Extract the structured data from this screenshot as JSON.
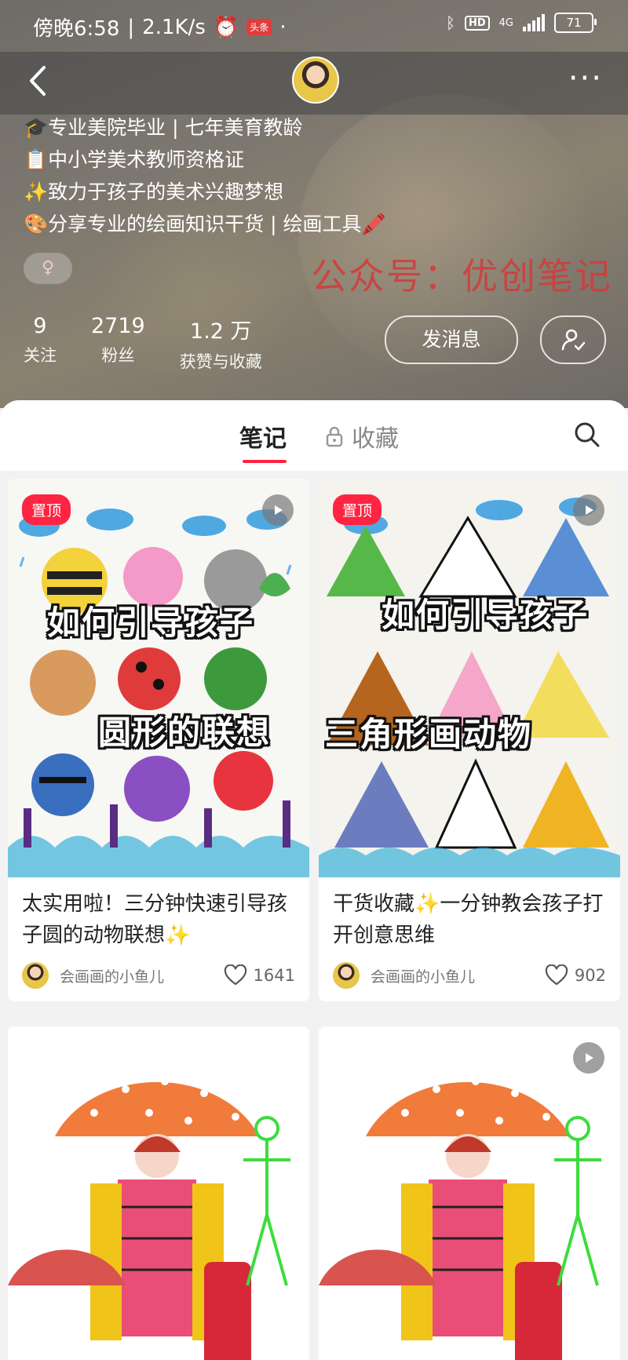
{
  "status_bar": {
    "time": "傍晚6:58",
    "speed": "2.1K/s",
    "app_badge": "头条",
    "dot": "·",
    "hd": "HD",
    "network": "4G",
    "battery": "71"
  },
  "nav": {
    "back_icon": "chevron-left-icon",
    "more_label": "···"
  },
  "bio": {
    "lines": [
      "🎓专业美院毕业 | 七年美育教龄",
      "📋中小学美术教师资格证",
      "✨致力于孩子的美术兴趣梦想",
      "🎨分享专业的绘画知识干货 | 绘画工具🖍️"
    ],
    "gender_symbol": "♀",
    "watermark": "公众号：优创笔记"
  },
  "stats": {
    "following": {
      "value": "9",
      "label": "关注"
    },
    "followers": {
      "value": "2719",
      "label": "粉丝"
    },
    "likes": {
      "value": "1.2 万",
      "label": "获赞与收藏"
    }
  },
  "actions": {
    "message_label": "发消息"
  },
  "tabs": {
    "notes": "笔记",
    "collections": "收藏"
  },
  "notes": [
    {
      "pinned_label": "置顶",
      "cover_line1": "如何引导孩子",
      "cover_line2": "圆形的联想",
      "title": "太实用啦！三分钟快速引导孩子圆的动物联想✨",
      "author": "会画画的小鱼儿",
      "likes": "1641"
    },
    {
      "pinned_label": "置顶",
      "cover_line1": "如何引导孩子",
      "cover_line2": "三角形画动物",
      "title": "干货收藏✨一分钟教会孩子打开创意思维",
      "author": "会画画的小鱼儿",
      "likes": "902"
    }
  ],
  "colors": {
    "accent": "#ff2442"
  }
}
